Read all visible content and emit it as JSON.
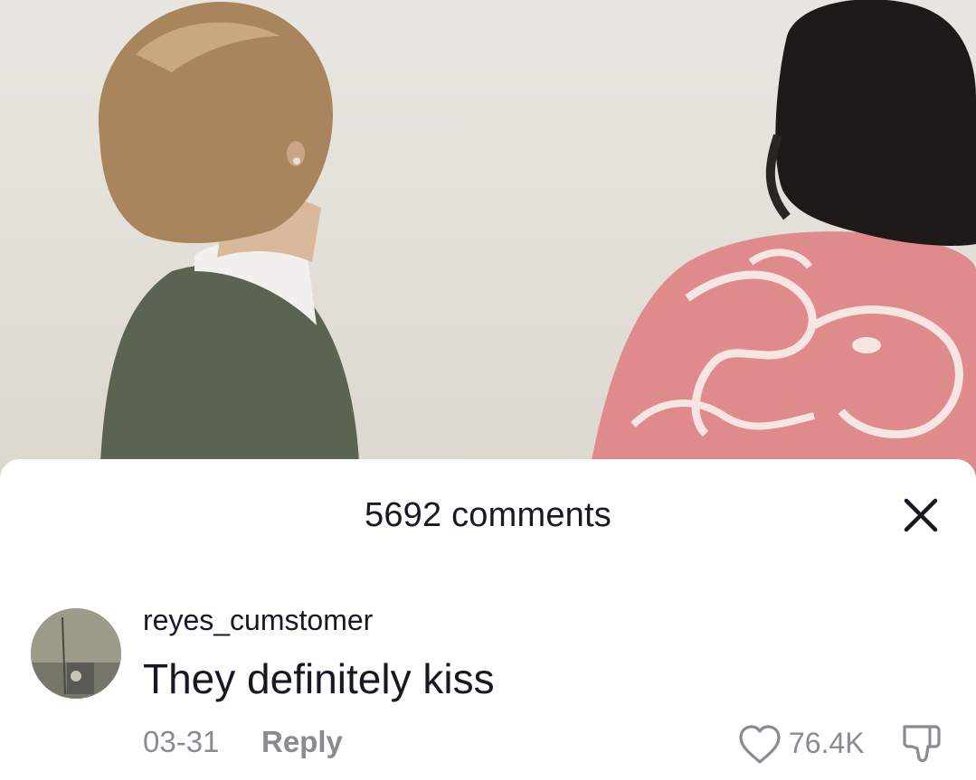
{
  "comments_panel": {
    "title": "5692 comments",
    "close_icon": "close-icon"
  },
  "comment": {
    "username": "reyes_cumstomer",
    "text": "They definitely kiss",
    "date": "03-31",
    "reply_label": "Reply",
    "like_count": "76.4K",
    "like_icon": "heart-outline-icon",
    "dislike_icon": "thumbs-down-icon"
  },
  "colors": {
    "text_primary": "#161823",
    "text_secondary": "#8a8b91",
    "sheet_background": "#ffffff"
  }
}
